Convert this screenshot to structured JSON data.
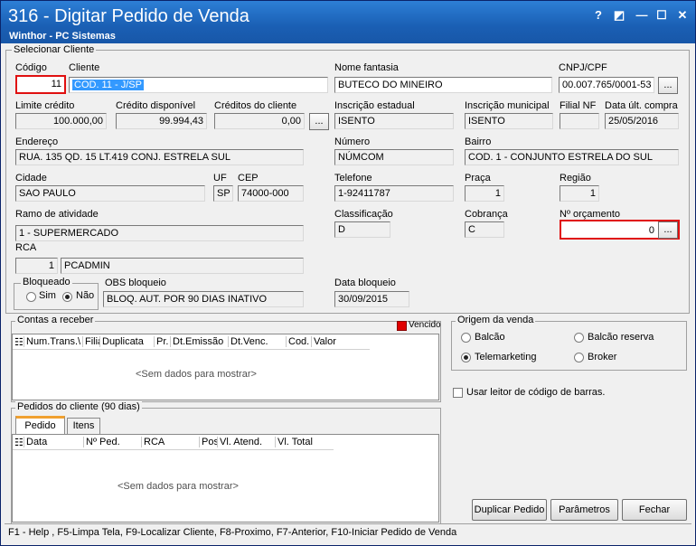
{
  "window": {
    "title": "316 - Digitar Pedido de Venda",
    "subtitle": "Winthor - PC Sistemas",
    "help_glyph": "?",
    "restore_glyph": "◩",
    "minimize_glyph": "—",
    "maximize_glyph": "☐",
    "close_glyph": "✕"
  },
  "client": {
    "group_title": "Selecionar Cliente",
    "codigo_label": "Código",
    "codigo_value": "11",
    "cliente_label": "Cliente",
    "cliente_value": "COD. 11 - J/SP",
    "fantasia_label": "Nome fantasia",
    "fantasia_value": "BUTECO DO MINEIRO",
    "cnpj_label": "CNPJ/CPF",
    "cnpj_value": "00.007.765/0001-53",
    "limite_label": "Limite crédito",
    "limite_value": "100.000,00",
    "credito_label": "Crédito disponível",
    "credito_value": "99.994,43",
    "creditos_label": "Créditos do cliente",
    "creditos_value": "0,00",
    "ie_label": "Inscrição estadual",
    "ie_value": "ISENTO",
    "im_label": "Inscrição municipal",
    "im_value": "ISENTO",
    "filial_label": "Filial NF",
    "filial_value": "",
    "data_ult_label": "Data últ. compra",
    "data_ult_value": "25/05/2016",
    "endereco_label": "Endereço",
    "endereco_value": "RUA. 135 QD. 15 LT.419 CONJ. ESTRELA SUL",
    "numero_label": "Número",
    "numero_value": "NÚMCOM",
    "bairro_label": "Bairro",
    "bairro_value": "COD. 1 - CONJUNTO ESTRELA DO SUL",
    "cidade_label": "Cidade",
    "cidade_value": "SAO PAULO",
    "uf_label": "UF",
    "uf_value": "SP",
    "cep_label": "CEP",
    "cep_value": "74000-000",
    "telefone_label": "Telefone",
    "telefone_value": "1-92411787",
    "praca_label": "Praça",
    "praca_value": "1",
    "regiao_label": "Região",
    "regiao_value": "1",
    "ramo_label": "Ramo de atividade",
    "ramo_value": "1 - SUPERMERCADO",
    "classificacao_label": "Classificação",
    "classificacao_value": "D",
    "cobranca_label": "Cobrança",
    "cobranca_value": "C",
    "orcamento_label": "Nº orçamento",
    "orcamento_value": "0",
    "rca_label": "RCA",
    "rca_code": "1",
    "rca_name": "PCADMIN",
    "bloqueado_label": "Bloqueado",
    "sim_label": "Sim",
    "nao_label": "Não",
    "obs_label": "OBS bloqueio",
    "obs_value": "BLOQ. AUT. POR 90 DIAS INATIVO",
    "data_bloq_label": "Data bloqueio",
    "data_bloq_value": "30/09/2015",
    "ellipsis": "..."
  },
  "contas": {
    "title": "Contas a receber",
    "vencido_label": "Vencido",
    "vencido_color": "#e00000",
    "columns": [
      "Num.Trans.\\",
      "Filia",
      "Duplicata",
      "Pr.",
      "Dt.Emissão",
      "Dt.Venc.",
      "Cod.",
      "Valor"
    ],
    "empty": "<Sem dados para mostrar>"
  },
  "origem": {
    "title": "Origem da venda",
    "options": [
      "Balcão",
      "Balcão reserva",
      "Telemarketing",
      "Broker"
    ],
    "selected": "Telemarketing",
    "barcode_label": "Usar leitor de código de barras."
  },
  "pedidos": {
    "title": "Pedidos do cliente (90 dias)",
    "tabs": [
      "Pedido",
      "Itens"
    ],
    "columns": [
      "Data",
      "Nº Ped.",
      "RCA",
      "Pos",
      "Vl. Atend.",
      "Vl. Total"
    ],
    "empty": "<Sem dados para mostrar>"
  },
  "buttons": {
    "duplicar": "Duplicar Pedido",
    "parametros": "Parâmetros",
    "fechar": "Fechar"
  },
  "status": "F1 - Help , F5-Limpa Tela, F9-Localizar Cliente, F8-Proximo, F7-Anterior, F10-Iniciar Pedido de Venda"
}
